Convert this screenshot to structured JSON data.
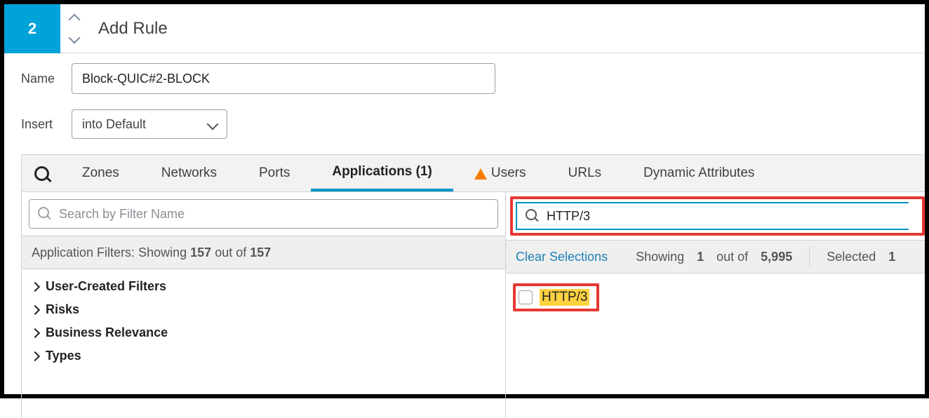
{
  "header": {
    "rule_number": "2",
    "title": "Add Rule"
  },
  "form": {
    "name_label": "Name",
    "name_value": "Block-QUIC#2-BLOCK",
    "insert_label": "Insert",
    "insert_value": "into Default"
  },
  "tabs": {
    "items": [
      {
        "label": "Zones"
      },
      {
        "label": "Networks"
      },
      {
        "label": "Ports"
      },
      {
        "label": "Applications (1)",
        "active": true
      },
      {
        "label": "Users",
        "warn": true
      },
      {
        "label": "URLs"
      },
      {
        "label": "Dynamic Attributes"
      }
    ]
  },
  "left": {
    "search_placeholder": "Search by Filter Name",
    "status_prefix": "Application Filters: Showing",
    "showing": "157",
    "out_of_label": "out of",
    "total": "157",
    "filters": [
      "User-Created Filters",
      "Risks",
      "Business Relevance",
      "Types"
    ]
  },
  "right": {
    "search_value": "HTTP/3",
    "clear_label": "Clear Selections",
    "showing_label": "Showing",
    "showing": "1",
    "out_of_label": "out of",
    "total": "5,995",
    "selected_label": "Selected",
    "selected": "1",
    "results": [
      {
        "label": "HTTP/3",
        "checked": false
      }
    ]
  }
}
